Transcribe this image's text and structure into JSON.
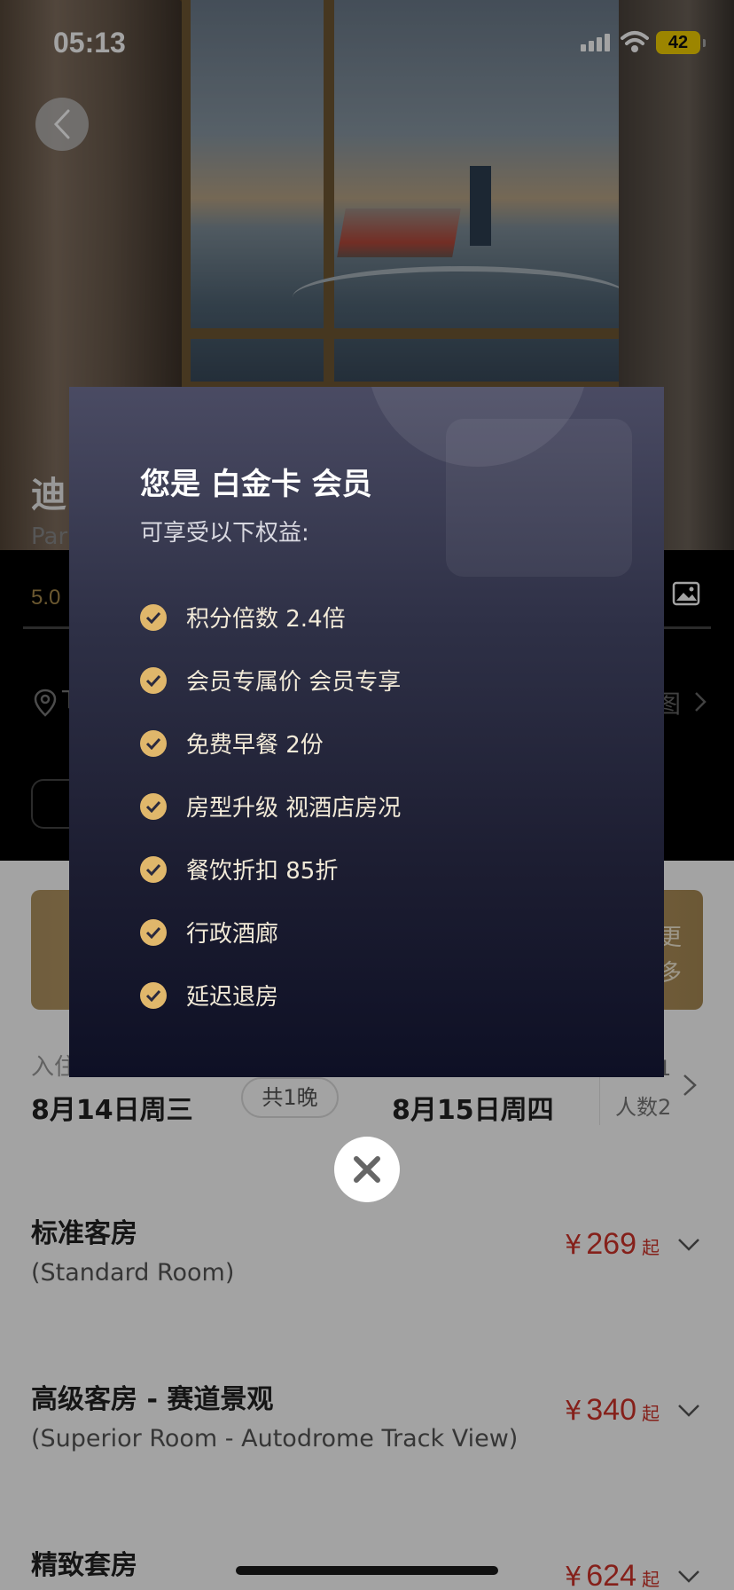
{
  "status_bar": {
    "time": "05:13",
    "battery": "42"
  },
  "hotel": {
    "title": "迪",
    "subtitle": "Par",
    "score": "5.0",
    "location_text": "T",
    "map_link": "图"
  },
  "member_banner": {
    "more_label": "更多"
  },
  "booking": {
    "checkin_label": "入住",
    "checkin_date": "8月14日周三",
    "nights": "共1晚",
    "checkout_date": "8月15日周四",
    "rooms": "1",
    "guests": "人数2"
  },
  "rooms": [
    {
      "name": "标准客房",
      "name_en": "(Standard Room)",
      "currency": "¥",
      "price": "269",
      "from": "起"
    },
    {
      "name": "高级客房 - 赛道景观",
      "name_en": "(Superior Room - Autodrome Track View)",
      "currency": "¥",
      "price": "340",
      "from": "起"
    },
    {
      "name": "精致套房",
      "name_en": "",
      "currency": "¥",
      "price": "624",
      "from": "起"
    }
  ],
  "modal": {
    "title": "您是 白金卡 会员",
    "subtitle": "可享受以下权益:",
    "benefits": [
      "积分倍数 2.4倍",
      "会员专属价 会员专享",
      "免费早餐 2份",
      "房型升级 视酒店房况",
      "餐饮折扣 85折",
      "行政酒廊",
      "延迟退房"
    ]
  },
  "colors": {
    "price_red": "#d0322a",
    "gold_check": "#e0b76b",
    "modal_bg_top": "#4a4b63",
    "modal_bg_bottom": "#0e1025"
  },
  "icons": [
    "back-chevron-icon",
    "signal-icon",
    "wifi-icon",
    "battery-icon",
    "gallery-icon",
    "location-pin-icon",
    "chevron-right-icon",
    "chevron-down-icon",
    "check-circle-icon",
    "close-icon"
  ]
}
